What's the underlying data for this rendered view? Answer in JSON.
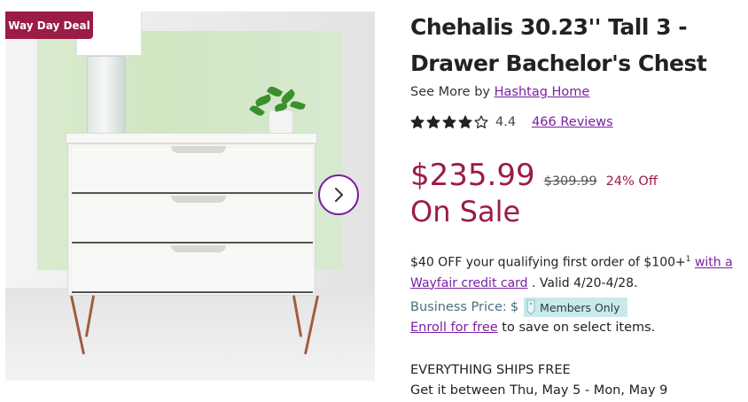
{
  "colors": {
    "accent": "#9b1c44",
    "link": "#7b1fa2",
    "business": "#4a6e7c",
    "members_badge_bg": "#c9e9ec"
  },
  "image": {
    "deal_badge": "Way Day Deal",
    "next_icon": "chevron-right-icon"
  },
  "product": {
    "title": "Chehalis 30.23'' Tall 3 - Drawer Bachelor's Chest",
    "see_more_prefix": "See More by",
    "brand": "Hashtag Home",
    "rating_value": "4.4",
    "rating_stars": 4.4,
    "reviews_label": "466 Reviews",
    "price": "$235.99",
    "was_price": "$309.99",
    "percent_off": "24% Off",
    "sale_label": "On Sale"
  },
  "promo": {
    "text_before_sup": "$40 OFF your qualifying first order of $100+",
    "sup": "1",
    "link_text": "with a Wayfair credit card",
    "text_after": ". Valid 4/20-4/28."
  },
  "business": {
    "label": "Business Price:",
    "currency": "$",
    "members_badge": "Members Only",
    "enroll_link": "Enroll for free",
    "enroll_suffix": "to save on select items."
  },
  "shipping": {
    "headline": "EVERYTHING SHIPS FREE",
    "delivery": "Get it between Thu, May 5 - Mon, May 9"
  }
}
